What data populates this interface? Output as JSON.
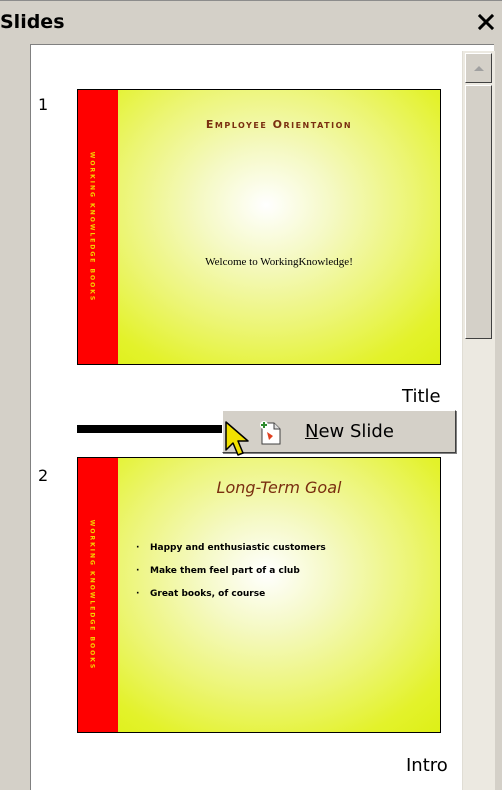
{
  "pane": {
    "title": "Slides",
    "close_glyph": "×"
  },
  "slides": [
    {
      "number": "1",
      "label": "Title",
      "stripe_text": "WORKING KNOWLEDGE BOOKS",
      "heading": "Employee Orientation",
      "body": "Welcome to WorkingKnowledge!"
    },
    {
      "number": "2",
      "label": "Intro",
      "stripe_text": "WORKING KNOWLEDGE BOOKS",
      "heading": "Long-Term Goal",
      "bullets": [
        "Happy and enthusiastic customers",
        "Make them feel part of a club",
        "Great books, of course"
      ]
    }
  ],
  "context_menu": {
    "item_label_accel": "N",
    "item_label_rest": "ew Slide",
    "icon": "new-slide-icon"
  },
  "colors": {
    "stripe": "#ff0000",
    "slide_bg": "#e3f22b",
    "heading": "#7a2f10",
    "stripe_text": "#f4d200"
  }
}
